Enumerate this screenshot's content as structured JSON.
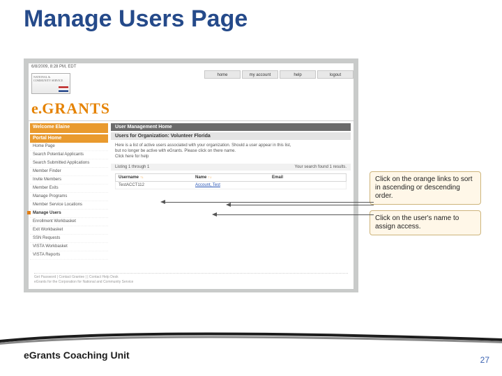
{
  "slide": {
    "title": "Manage Users Page"
  },
  "timestamp": "6/8/2009, 8:28 PM, EDT",
  "topbar": [
    "home",
    "my account",
    "help",
    "logout"
  ],
  "logo_text": "NATIONAL & COMMUNITY SERVICE",
  "brand": {
    "e": "e.",
    "rest": "GRANTS"
  },
  "sidebar": {
    "welcome": "Welcome Elaine",
    "portal_home": "Portal Home",
    "items": [
      "Home Page",
      "Search Potential Applicants",
      "Search Submitted Applications",
      "Member Finder",
      "Invite Members",
      "Member Exits",
      "Manage Programs",
      "Member Service Locations",
      "Manage Users",
      "Enrollment Workbasket",
      "Exit Workbasket",
      "SSN Requests",
      "VISTA Workbasket",
      "VISTA Reports"
    ],
    "active_index": 8
  },
  "main": {
    "panel_head": "User Management Home",
    "sub_head": "Users for Organization: Volunteer Florida",
    "body_lines": [
      "Here is a list of active users associated with your organization. Should a user appear in this list,",
      "but no longer be active with eGrants. Please click on there name.",
      "Click here for help"
    ],
    "stripe_left": "Listing 1 through 1",
    "stripe_right": "Your search found 1 results.",
    "columns": [
      {
        "label": "Username",
        "sort": "↑↓"
      },
      {
        "label": "Name",
        "sort": "↑↓"
      },
      {
        "label": "Email",
        "sort": ""
      }
    ],
    "row": {
      "username": "TestACCT112",
      "name": "Account, Test",
      "email": ""
    }
  },
  "footer_app": [
    "Get Password | Contact Grantee | | Contact Help Desk",
    "eGrants for the Corporation for National and Community Service"
  ],
  "callouts": {
    "c1": "Click on the orange links to sort in ascending or descending order.",
    "c2": "Click on the user's name to assign access."
  },
  "footer": {
    "unit": "eGrants Coaching Unit",
    "page": "27"
  }
}
